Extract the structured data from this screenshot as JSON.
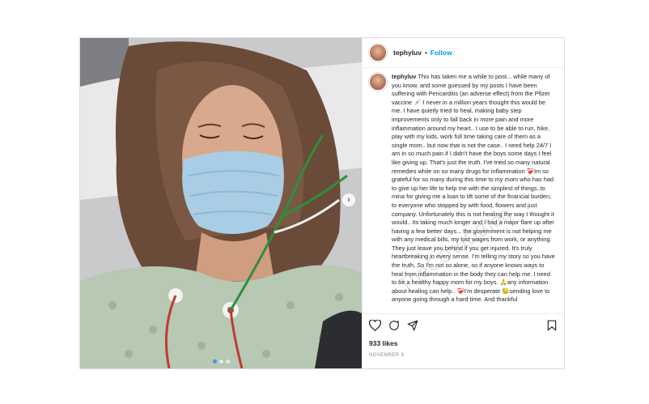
{
  "post": {
    "username": "tephyluv",
    "separator": "•",
    "follow_label": "Follow",
    "caption_username": "tephyluv",
    "caption": "This has taken me a while to post... while many of you know, and some guessed by my posts I have been suffering with Pericarditis (an adverse effect) from the Pfizer vaccine 💉 I never in a million years thought this would be me. I have quietly tried to heal, making baby step improvements only to fall back in more pain and more inflammation around my heart.. I use to be able to run, hike, play with my kids, work full time taking care of them as a single mom.. but now that is not the case.. I need help 24/7 I am in so much pain if I didn't have the boys some days I feel like giving up. That's just the truth. I've tried so many natural remedies while on so many drugs for inflammation ❤️‍🩹Im so grateful for so many during this time to my mom who has had to give up her life to help me with the simplest of things..to mina for giving me a loan to lift some of the financial burden, to everyone who stopped by with food, flowers and just company. Unfortunately this is not healing the way I thought it would.. Its taking much longer and I had a major flare up after having a few better days... the government is not helping me with any medical bills, my lost wages from work, or anything. They just leave you behind if you get injured. It's truly heartbreaking in every sense. I'm telling my story so you have the truth, So I'm not so alone, so if anyone knows ways to heal from inflammation in the body they can help me. I need to be a healthy happy mom for my boys. 🙏any information about healing can help.. ❤️‍🩹I'm desperate 😓sending love to anyone going through a hard time. And thankful",
    "watermark": "TheCOVIDBlog",
    "likes": "933 likes",
    "date": "NOVEMBER 8",
    "next_arrow": "›",
    "icons": {
      "like": "heart-icon",
      "comment": "comment-icon",
      "share": "share-icon",
      "save": "bookmark-icon"
    }
  }
}
